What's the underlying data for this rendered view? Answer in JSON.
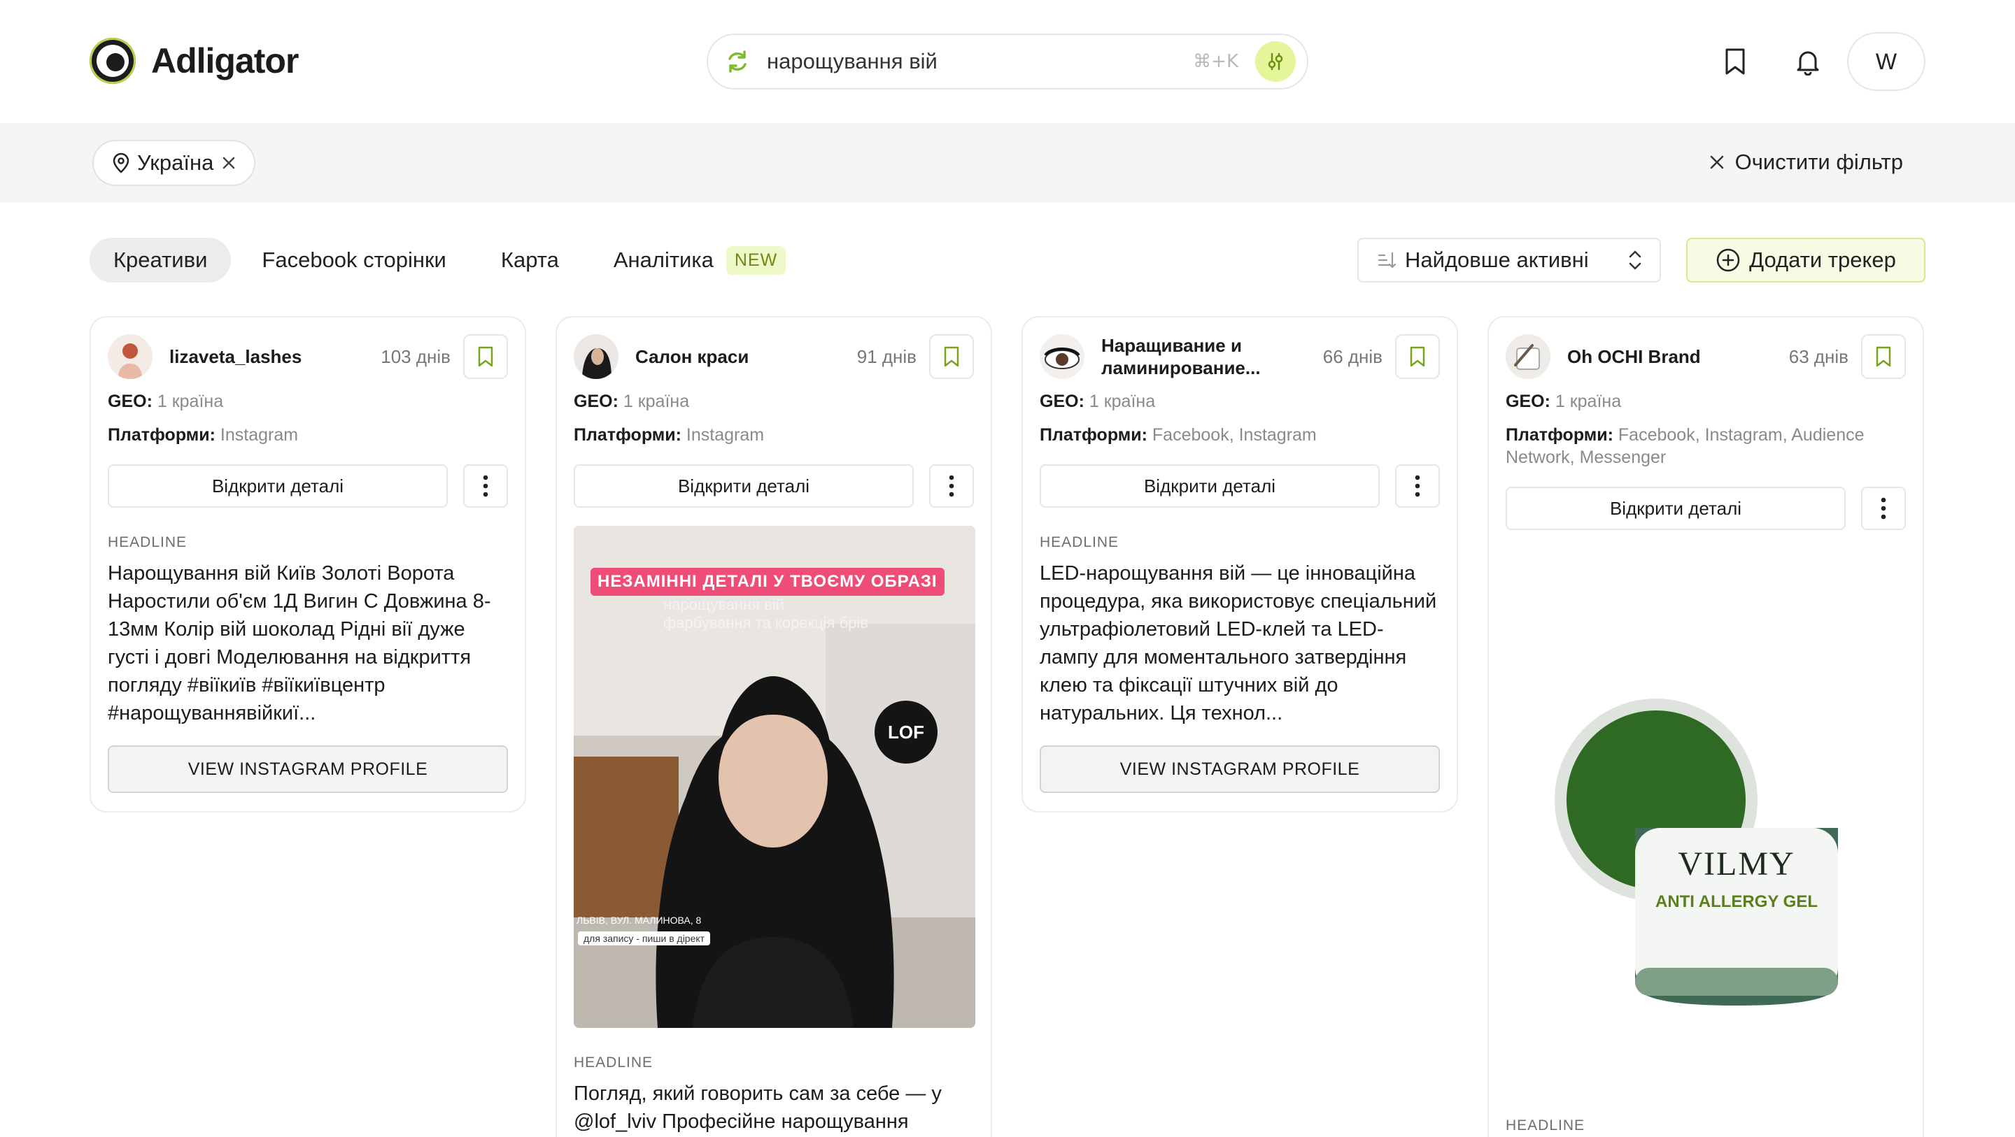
{
  "brand": {
    "name": "Adligator"
  },
  "search": {
    "value": "нарощування вій",
    "shortcut": "⌘+K"
  },
  "header": {
    "avatar_letter": "W"
  },
  "filters": {
    "location_chip": "Україна",
    "clear_label": "Очистити фільтр"
  },
  "tabs": [
    {
      "label": "Креативи",
      "active": true
    },
    {
      "label": "Facebook сторінки"
    },
    {
      "label": "Карта"
    },
    {
      "label": "Аналітика",
      "badge": "NEW"
    }
  ],
  "sort": {
    "label": "Найдовше активні"
  },
  "add_tracker": {
    "label": "Додати трекер"
  },
  "labels": {
    "geo": "GEO:",
    "platforms": "Платформи:",
    "open_details": "Відкрити деталі",
    "headline": "HEADLINE",
    "view_profile": "VIEW INSTAGRAM PROFILE"
  },
  "cards": [
    {
      "name": "lizaveta_lashes",
      "days": "103 днів",
      "geo": "1 країна",
      "platforms": "Instagram",
      "headline": "Нарощування вій Київ Золоті Ворота Наростили об'єм 1Д Вигин С Довжина 8-13мм Колір вій шоколад Рідні вії дуже густі і довгі Моделювання на відкриття погляду #віїкиїв #віїкиївцентр #нарощуваннявійкиї..."
    },
    {
      "name": "Салон краси",
      "days": "91 днів",
      "geo": "1 країна",
      "platforms": "Instagram",
      "media": {
        "banner": "НЕЗАМІННІ ДЕТАЛІ У ТВОЄМУ ОБРАЗІ",
        "subtitle_1": "нарощування вій",
        "subtitle_2": "фарбування та корекція брів",
        "logo": "LOF",
        "address": "ЛЬВІВ, ВУЛ. МАЛИНОВА, 8",
        "note": "для запису - пиши в дірект"
      },
      "headline": "Погляд, який говорить сам за себе — у @lof_lviv Професійне нарощування"
    },
    {
      "name": "Наращивание и ламинирование...",
      "days": "66 днів",
      "geo": "1 країна",
      "platforms": "Facebook, Instagram",
      "headline": "LED-нарощування вій — це інноваційна процедура, яка використовує спеціальний ультрафіолетовий LED-клей та LED-лампу для моментального затвердіння клею та фіксації штучних вій до натуральних. Ця технол..."
    },
    {
      "name": "Oh OCHI Brand",
      "days": "63 днів",
      "geo": "1 країна",
      "platforms": "Facebook, Instagram, Audience Network, Messenger",
      "product": {
        "title": "VILMY",
        "subtitle": "ANTI ALLERGY GEL"
      }
    }
  ],
  "colors": {
    "accent": "#b7d34a",
    "accent_soft": "#e4f59a",
    "badge_bg": "#eef9c9",
    "banner": "#ef4d78"
  }
}
